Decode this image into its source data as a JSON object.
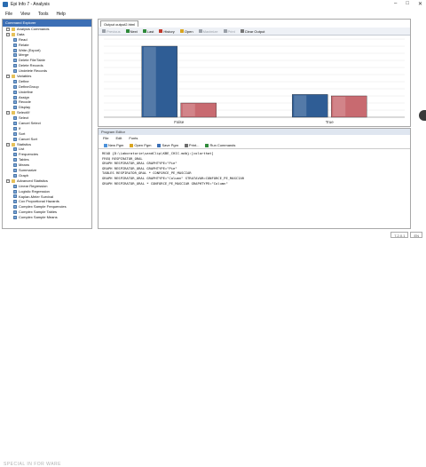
{
  "app": {
    "title": "Epi Info 7 - Analysis"
  },
  "window_controls": [
    "–",
    "□",
    "✕"
  ],
  "menubar": [
    "File",
    "View",
    "Tools",
    "Help"
  ],
  "left_panel": {
    "header": "Command Explorer",
    "items": [
      {
        "kind": "cat",
        "label": "Analysis Commands",
        "exp": "−"
      },
      {
        "kind": "cat",
        "label": "Data",
        "exp": "−"
      },
      {
        "kind": "leaf",
        "label": "Read"
      },
      {
        "kind": "leaf",
        "label": "Relate"
      },
      {
        "kind": "leaf",
        "label": "Write (Export)"
      },
      {
        "kind": "leaf",
        "label": "Merge"
      },
      {
        "kind": "leaf",
        "label": "Delete File/Table"
      },
      {
        "kind": "leaf",
        "label": "Delete Records"
      },
      {
        "kind": "leaf",
        "label": "Undelete Records"
      },
      {
        "kind": "cat",
        "label": "Variables",
        "exp": "−"
      },
      {
        "kind": "leaf",
        "label": "Define"
      },
      {
        "kind": "leaf",
        "label": "DefineGroup"
      },
      {
        "kind": "leaf",
        "label": "Undefine"
      },
      {
        "kind": "leaf",
        "label": "Assign"
      },
      {
        "kind": "leaf",
        "label": "Recode"
      },
      {
        "kind": "leaf",
        "label": "Display"
      },
      {
        "kind": "cat",
        "label": "Select/If",
        "exp": "−"
      },
      {
        "kind": "leaf",
        "label": "Select"
      },
      {
        "kind": "leaf",
        "label": "Cancel Select"
      },
      {
        "kind": "leaf",
        "label": "If"
      },
      {
        "kind": "leaf",
        "label": "Sort"
      },
      {
        "kind": "leaf",
        "label": "Cancel Sort"
      },
      {
        "kind": "cat",
        "label": "Statistics",
        "exp": "−"
      },
      {
        "kind": "leaf",
        "label": "List"
      },
      {
        "kind": "leaf",
        "label": "Frequencies"
      },
      {
        "kind": "leaf",
        "label": "Tables"
      },
      {
        "kind": "leaf",
        "label": "Means"
      },
      {
        "kind": "leaf",
        "label": "Summarize"
      },
      {
        "kind": "leaf",
        "label": "Graph"
      },
      {
        "kind": "cat",
        "label": "Advanced Statistics",
        "exp": "−"
      },
      {
        "kind": "leaf",
        "label": "Linear Regression"
      },
      {
        "kind": "leaf",
        "label": "Logistic Regression"
      },
      {
        "kind": "leaf",
        "label": "Kaplan-Meier Survival"
      },
      {
        "kind": "leaf",
        "label": "Cox Proportional Hazards"
      },
      {
        "kind": "leaf",
        "label": "Complex Sample Frequencies"
      },
      {
        "kind": "leaf",
        "label": "Complex Sample Tables"
      },
      {
        "kind": "leaf",
        "label": "Complex Sample Means"
      }
    ]
  },
  "output": {
    "tab": "Output output2.html",
    "toolbar": [
      {
        "label": "Previous",
        "dim": true,
        "color": "#9aa0a8"
      },
      {
        "label": "Next",
        "dim": false,
        "color": "#2f8a3a"
      },
      {
        "label": "Last",
        "dim": false,
        "color": "#2f8a3a"
      },
      {
        "label": "History",
        "dim": false,
        "color": "#c0392b"
      },
      {
        "label": "Open",
        "dim": false,
        "color": "#d9a520"
      },
      {
        "label": "Maximize",
        "dim": true,
        "color": "#9aa0a8"
      },
      {
        "label": "Print",
        "dim": true,
        "color": "#9aa0a8"
      },
      {
        "label": "Clear Output",
        "dim": false,
        "color": "#777777"
      }
    ]
  },
  "chart_data": {
    "type": "bar",
    "categories": [
      "False",
      "True"
    ],
    "series": [
      {
        "values": [
          100,
          32
        ],
        "color": "#2f5d95"
      },
      {
        "values": [
          20,
          30
        ],
        "color": "#c86a70"
      }
    ],
    "ylim": [
      0,
      110
    ],
    "grid": true
  },
  "program": {
    "header": "Program Editor",
    "menu": [
      "File",
      "Edit",
      "Fonts"
    ],
    "tools": [
      "New Pgm",
      "Open Pgm",
      "Save Pgm",
      "Print...",
      "Run Commands"
    ],
    "lines": [
      "READ {D:\\Laboratorie\\sandClip\\KBE_CHIC.mdb}:[colorthat]",
      "FREQ RESPIRATOR_ORAL",
      "GRAPH RESPIRATOR_ORAL GRAPHTYPE=\"Pie\"",
      "GRAPH RESPIRATOR_ORAL GRAPHTYPE=\"Pie\"",
      "TABLES RESPIRATOR_ORAL * CONFORCE_PE_MASCIAR",
      "GRAPH RESPIRATOR_ORAL GRAPHTYPE=\"Column\" STRATAVAR=CONFORCE_PE_MASCIAR",
      "GRAPH RESPIRATOR_ORAL * CONFORCE_PE_MASCIAR GRAPHTYPE=\"Column\""
    ]
  },
  "status": {
    "watermark": "SPECIAL IN  FOR WARE",
    "segments": [
      "7.2.0.1",
      "EN"
    ]
  }
}
